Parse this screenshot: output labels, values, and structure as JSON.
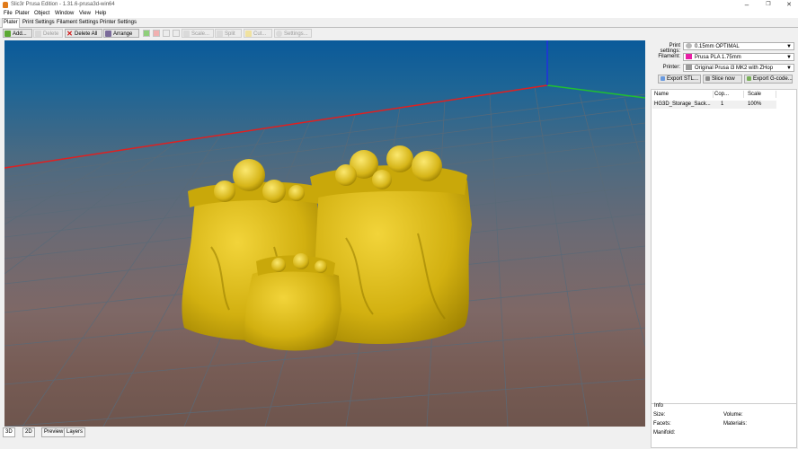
{
  "window": {
    "title": "Slic3r Prusa Edition - 1.31.6-prusa3d-win64",
    "controls": {
      "minimize": "–",
      "maximize": "❐",
      "close": "✕"
    }
  },
  "menu": [
    "File",
    "Plater",
    "Object",
    "Window",
    "View",
    "Help"
  ],
  "tabs": [
    "Plater",
    "Print Settings",
    "Filament Settings",
    "Printer Settings"
  ],
  "toolbar": {
    "add": "Add...",
    "delete": "Delete",
    "delete_all": "Delete All",
    "arrange": "Arrange",
    "scale": "Scale...",
    "split": "Split",
    "cut": "Cut...",
    "settings": "Settings..."
  },
  "view_tabs": [
    "3D",
    "2D",
    "Preview",
    "Layers"
  ],
  "settings": {
    "print_label": "Print settings:",
    "print_value": "0.15mm OPTIMAL",
    "filament_label": "Filament:",
    "filament_value": "Prusa PLA 1.75mm",
    "filament_color": "#e81ea6",
    "printer_label": "Printer:",
    "printer_value": "Original Prusa i3 MK2 with ZHop"
  },
  "actions": {
    "export_stl": "Export STL...",
    "slice_now": "Slice now",
    "export_gcode": "Export G-code..."
  },
  "object_list": {
    "columns": [
      "Name",
      "Cop...",
      "Scale"
    ],
    "rows": [
      {
        "name": "HG3D_Storage_Sack...",
        "copies": "1",
        "scale": "100%"
      }
    ]
  },
  "info": {
    "title": "Info",
    "size_label": "Size:",
    "volume_label": "Volume:",
    "facets_label": "Facets:",
    "materials_label": "Materials:",
    "manifold_label": "Manifold:"
  },
  "colors": {
    "model": "#d4b50a",
    "x_axis": "#e02020",
    "y_axis": "#20c030",
    "z_axis": "#2030e0"
  }
}
